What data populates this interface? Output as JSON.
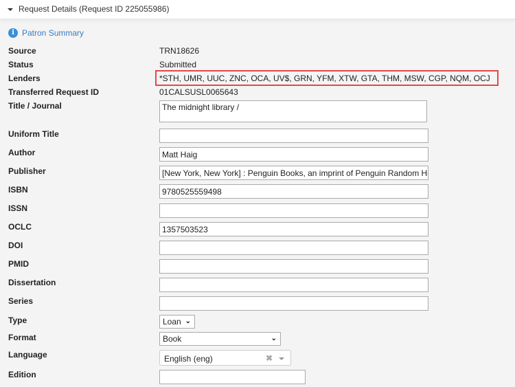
{
  "header": {
    "title": "Request Details (Request ID 225055986)"
  },
  "patron_summary": {
    "label": "Patron Summary",
    "icon": "info-icon"
  },
  "info": {
    "source_label": "Source",
    "source": "TRN18626",
    "status_label": "Status",
    "status": "Submitted",
    "lenders_label": "Lenders",
    "lenders": "*STH, UMR, UUC, ZNC, OCA, UV$, GRN, YFM, XTW, GTA, THM, MSW, CGP, NQM, OCJ",
    "transferred_label": "Transferred Request ID",
    "transferred": "01CALSUSL0065643"
  },
  "fields": {
    "title_label": "Title / Journal",
    "title": "The midnight library /",
    "uniform_label": "Uniform Title",
    "uniform": "",
    "author_label": "Author",
    "author": "Matt Haig",
    "publisher_label": "Publisher",
    "publisher": "[New York, New York] : Penguin Books, an imprint of Penguin Random House",
    "isbn_label": "ISBN",
    "isbn": "9780525559498",
    "issn_label": "ISSN",
    "issn": "",
    "oclc_label": "OCLC",
    "oclc": "1357503523",
    "doi_label": "DOI",
    "doi": "",
    "pmid_label": "PMID",
    "pmid": "",
    "dissertation_label": "Dissertation",
    "dissertation": "",
    "series_label": "Series",
    "series": "",
    "type_label": "Type",
    "type": "Loan",
    "format_label": "Format",
    "format": "Book",
    "language_label": "Language",
    "language": "English (eng)",
    "edition_label": "Edition",
    "edition": ""
  },
  "highlight_color": "#e84545"
}
